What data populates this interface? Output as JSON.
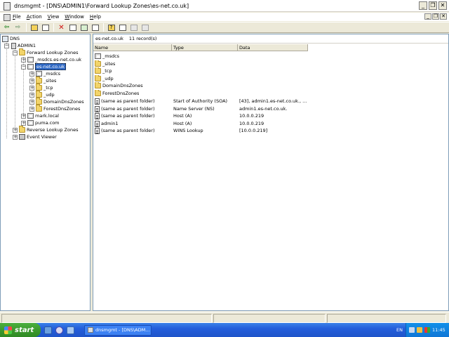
{
  "window": {
    "title": "dnsmgmt - [DNS\\ADMIN1\\Forward Lookup Zones\\es-net.co.uk]",
    "minimize_glyph": "_",
    "restore_glyph": "❐",
    "close_glyph": "✕"
  },
  "menu": {
    "items": [
      "File",
      "Action",
      "View",
      "Window",
      "Help"
    ],
    "mdi_minimize": "_",
    "mdi_restore": "❐",
    "mdi_close": "✕"
  },
  "toolbar": {
    "buttons": [
      "back-arrow-icon",
      "forward-arrow-icon",
      "up-folder-icon",
      "show-hide-tree-icon",
      "delete-icon",
      "properties-icon",
      "refresh-icon",
      "export-list-icon",
      "help-icon",
      "server-icon",
      "record-icon",
      "disabled-icon"
    ],
    "back_glyph": "⇦",
    "forward_glyph": "⇨",
    "delete_glyph": "✕",
    "help_glyph": "?"
  },
  "tree": {
    "root": "DNS",
    "server": "ADMIN1",
    "forward_zones": "Forward Lookup Zones",
    "msdcs_zone": "_msdcs.es-net.co.uk",
    "selected_zone": "es-net.co.uk",
    "subfolders": [
      "_msdcs",
      "_sites",
      "_tcp",
      "_udp",
      "DomainDnsZones",
      "ForestDnsZones"
    ],
    "other_zones": [
      "mark.local",
      "puma.com"
    ],
    "reverse_zones": "Reverse Lookup Zones",
    "event_viewer": "Event Viewer",
    "expand_glyph": "+",
    "collapse_glyph": "−"
  },
  "details": {
    "zone_name": "es-net.co.uk",
    "record_count": "11 record(s)",
    "columns": [
      "Name",
      "Type",
      "Data"
    ],
    "folders": [
      "_msdcs",
      "_sites",
      "_tcp",
      "_udp",
      "DomainDnsZones",
      "ForestDnsZones"
    ],
    "records": [
      {
        "name": "(same as parent folder)",
        "type": "Start of Authority (SOA)",
        "data": "[43], admin1.es-net.co.uk., ..."
      },
      {
        "name": "(same as parent folder)",
        "type": "Name Server (NS)",
        "data": "admin1.es-net.co.uk."
      },
      {
        "name": "(same as parent folder)",
        "type": "Host (A)",
        "data": "10.0.0.219"
      },
      {
        "name": "admin1",
        "type": "Host (A)",
        "data": "10.0.0.219"
      },
      {
        "name": "(same as parent folder)",
        "type": "WINS Lookup",
        "data": "[10.0.0.219]"
      }
    ]
  },
  "taskbar": {
    "start_label": "start",
    "task_label": "dnsmgmt - [DNS\\ADM...",
    "language": "EN",
    "clock": "11:45"
  }
}
